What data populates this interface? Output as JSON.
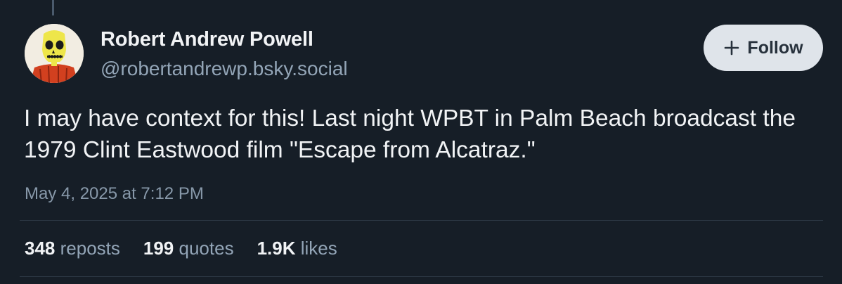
{
  "author": {
    "name": "Robert Andrew Powell",
    "handle": "@robertandrewp.bsky.social",
    "avatar": "skeleton-avatar"
  },
  "follow_button": {
    "label": "Follow",
    "icon": "plus-icon"
  },
  "post": {
    "text": "I may have context for this! Last night WPBT in Palm Beach broadcast the 1979 Clint Eastwood film \"Escape from Alcatraz.\"",
    "timestamp": "May 4, 2025 at 7:12 PM"
  },
  "stats": [
    {
      "count": "348",
      "label": "reposts"
    },
    {
      "count": "199",
      "label": "quotes"
    },
    {
      "count": "1.9K",
      "label": "likes"
    }
  ],
  "colors": {
    "background": "#161e27",
    "text_primary": "#f1f3f5",
    "text_secondary": "#93a5b7",
    "follow_bg": "#dfe4ea",
    "divider": "#2d3945"
  }
}
